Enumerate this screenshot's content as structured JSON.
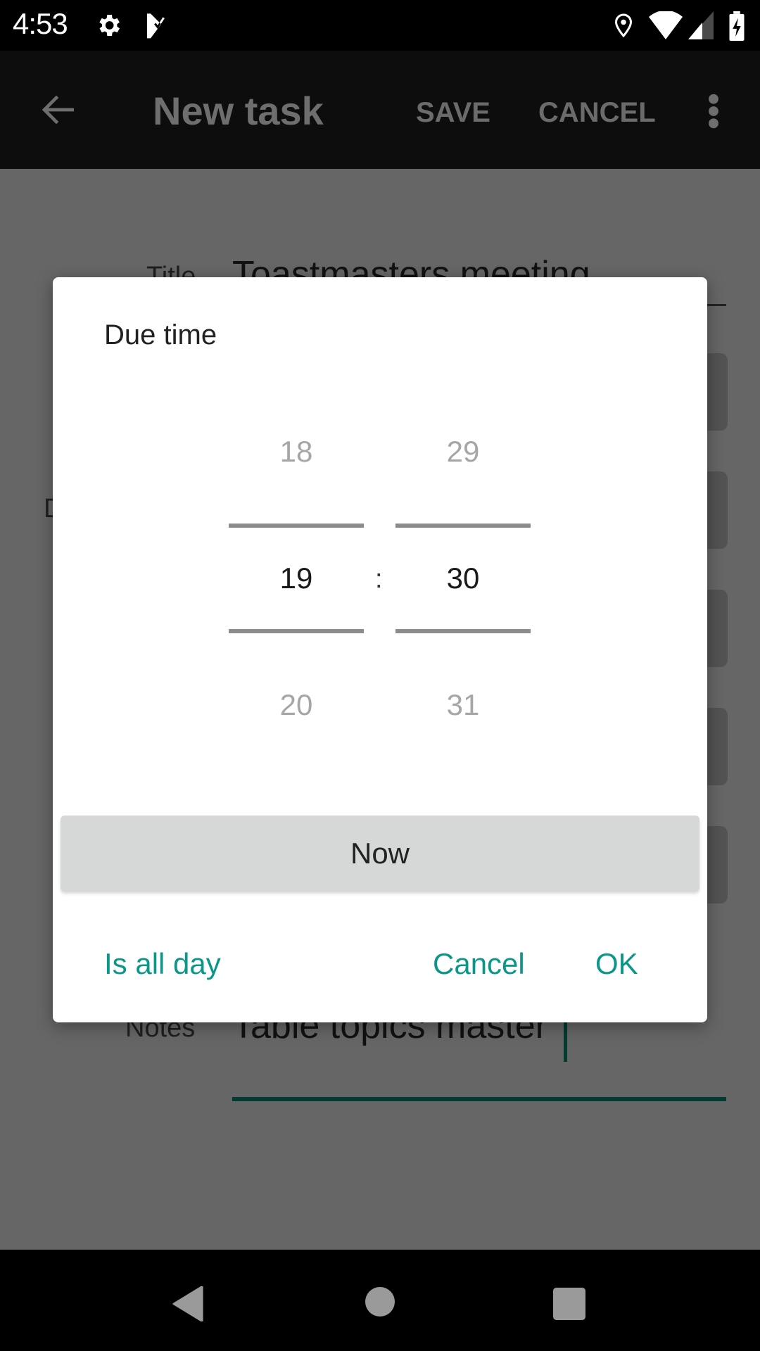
{
  "status_bar": {
    "time": "4:53",
    "left_icons": [
      "gear-icon",
      "task-check-icon"
    ],
    "right_icons": [
      "location-icon",
      "wifi-icon",
      "signal-icon",
      "battery-charging-icon"
    ]
  },
  "app_bar": {
    "back_icon": "arrow-back-icon",
    "title": "New task",
    "actions": [
      "SAVE",
      "CANCEL"
    ],
    "overflow_icon": "more-vert-icon"
  },
  "form": {
    "title_label": "Title",
    "title_value": "Toastmasters meeting",
    "notes_label": "Notes",
    "notes_value": "Table topics master",
    "partial_label": "D"
  },
  "dialog": {
    "title": "Due time",
    "hours": {
      "prev": "18",
      "selected": "19",
      "next": "20"
    },
    "separator": ":",
    "minutes": {
      "prev": "29",
      "selected": "30",
      "next": "31"
    },
    "now_label": "Now",
    "all_day_label": "Is all day",
    "cancel_label": "Cancel",
    "ok_label": "OK",
    "accent_color": "#0c968a"
  },
  "nav_bar": {
    "icons": [
      "nav-back-icon",
      "nav-home-icon",
      "nav-recents-icon"
    ]
  }
}
